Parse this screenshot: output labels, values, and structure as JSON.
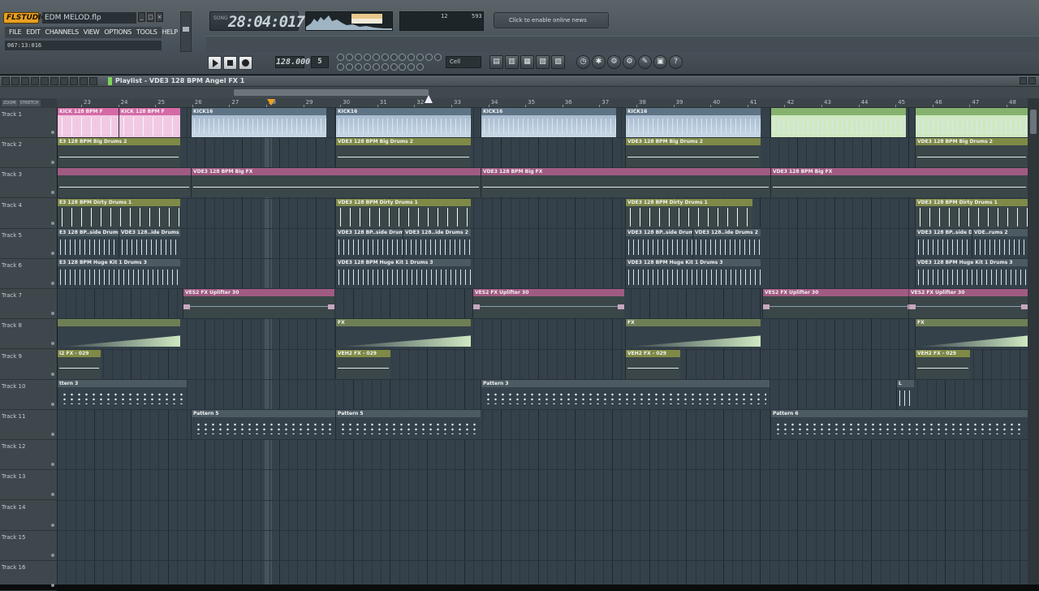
{
  "app": {
    "logo": "FLSTUDIO",
    "project_file": "EDM MELOD.flp",
    "menu": [
      "FILE",
      "EDIT",
      "CHANNELS",
      "VIEW",
      "OPTIONS",
      "TOOLS",
      "HELP"
    ],
    "hint": "067:13:016",
    "time": "28:04:017",
    "time_label": "SONG",
    "cpu_val1": "12",
    "cpu_val2": "593",
    "news": "Click to enable online news",
    "tempo": "128.000",
    "pattern": "5",
    "snap": "Cell"
  },
  "playlist": {
    "title": "Playlist - VDE3 128 BPM Angel FX 1",
    "ruler": [
      "23",
      "24",
      "25",
      "26",
      "27",
      "28",
      "29",
      "30",
      "31",
      "32",
      "33",
      "34",
      "35",
      "36",
      "37",
      "38",
      "39",
      "40",
      "41",
      "42",
      "43",
      "44",
      "45",
      "46",
      "47",
      "48"
    ],
    "tracks": [
      "Track 1",
      "Track 2",
      "Track 3",
      "Track 4",
      "Track 5",
      "Track 6",
      "Track 7",
      "Track 8",
      "Track 9",
      "Track 10",
      "Track 11",
      "Track 12",
      "Track 13",
      "Track 14",
      "Track 15",
      "Track 16"
    ],
    "clips": {
      "t1a": "KICK 128 BPM F",
      "t1b": "KICK 128 BPM F",
      "t1c": "KICK16",
      "t1d": "KICK16",
      "t2": "E3 128 BPM Big Drums 2",
      "t2b": "VDE3 128 BPM Big Drums 2",
      "t3": "VDE3 128 BPM Big FX",
      "t4": "E3 128 BPM Dirty Drums 1",
      "t4b": "VDE3 128 BPM Dirty Drums 1",
      "t5": "E3 128 BP..side Drums 2",
      "t5b": "VDE3 128..ide Drums 2",
      "t5c": "VDE3 128 BP..side Drums 2",
      "t5d": "VDE..rums 2",
      "t6": "E3 128 BPM Huge Kit 1 Drums 3",
      "t6b": "VDE3 128 BPM Huge Kit 1 Drums 3",
      "t7": "VES2 FX Uplifter 30",
      "t8": "FX",
      "t9": "I2 FX - 029",
      "t9b": "VEH2 FX - 029",
      "t10": "ttern 3",
      "t10b": "Pattern 3",
      "t10c": "L",
      "t11": "Pattern 5",
      "t11b": "Pattern 6"
    }
  }
}
